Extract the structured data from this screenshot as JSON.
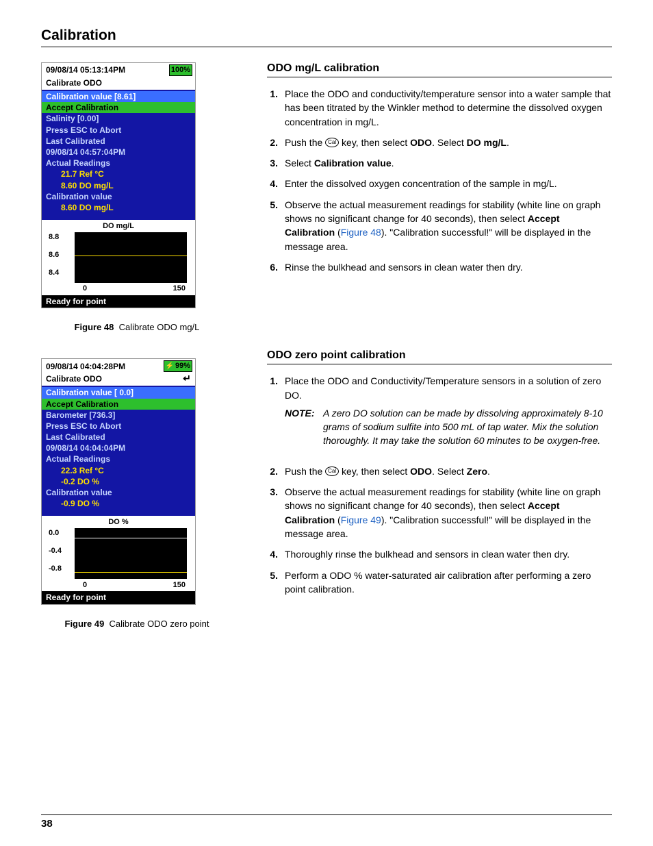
{
  "page_title": "Calibration",
  "page_number": "38",
  "device1": {
    "timestamp": "09/08/14 05:13:14PM",
    "battery": "100%",
    "subtitle": "Calibrate ODO",
    "cal_value_row": "Calibration value [8.61]",
    "accept_row": "Accept Calibration",
    "salinity_row": "Salinity [0.00]",
    "esc_row": "Press ESC to Abort",
    "last_cal_label": "Last Calibrated",
    "last_cal_time": "09/08/14 04:57:04PM",
    "actual_readings_label": "Actual Readings",
    "reading1": "21.7 Ref °C",
    "reading2": "8.60 DO mg/L",
    "cal_value_label": "Calibration value",
    "cal_value_reading": "8.60 DO mg/L",
    "graph_title": "DO mg/L",
    "y1": "8.8",
    "y2": "8.6",
    "y3": "8.4",
    "x1": "0",
    "x2": "150",
    "footer": "Ready for point"
  },
  "fig48": {
    "label": "Figure 48",
    "text": "Calibrate ODO mg/L"
  },
  "device2": {
    "timestamp": "09/08/14 04:04:28PM",
    "battery": "99%",
    "subtitle": "Calibrate ODO",
    "cal_value_row": "Calibration value [ 0.0]",
    "accept_row": "Accept Calibration",
    "barometer_row": "Barometer [736.3]",
    "esc_row": "Press ESC to Abort",
    "last_cal_label": "Last Calibrated",
    "last_cal_time": "09/08/14 04:04:04PM",
    "actual_readings_label": "Actual Readings",
    "reading1": "22.3 Ref °C",
    "reading2": "-0.2 DO %",
    "cal_value_label": "Calibration value",
    "cal_value_reading": "-0.9 DO %",
    "graph_title": "DO %",
    "y1": "0.0",
    "y2": "-0.4",
    "y3": "-0.8",
    "x1": "0",
    "x2": "150",
    "footer": "Ready for point"
  },
  "fig49": {
    "label": "Figure 49",
    "text": "Calibrate ODO zero point"
  },
  "section1": {
    "title": "ODO mg/L calibration",
    "step1": "Place the ODO and conductivity/temperature sensor into a water sample that has been titrated by the Winkler method to determine the dissolved oxygen concentration in mg/L.",
    "step2_pre": "Push the ",
    "step2_mid": " key, then select ",
    "step2_b1": "ODO",
    "step2_mid2": ". Select ",
    "step2_b2": "DO mg/L",
    "step2_post": ".",
    "step3_pre": "Select ",
    "step3_b": "Calibration value",
    "step3_post": ".",
    "step4": "Enter the dissolved oxygen concentration of the sample in mg/L.",
    "step5_pre": "Observe the actual measurement readings for stability (white line on graph shows no significant change for 40 seconds), then select ",
    "step5_b": "Accept Calibration",
    "step5_mid": " (",
    "step5_link": "Figure 48",
    "step5_post": "). \"Calibration successful!\" will be displayed in the message area.",
    "step6": "Rinse the bulkhead and sensors in clean water then dry."
  },
  "section2": {
    "title": "ODO zero point calibration",
    "step1": "Place the ODO and Conductivity/Temperature sensors in a solution of zero DO.",
    "note_label": "NOTE:",
    "note_body": "A zero DO solution can be made by dissolving approximately 8-10 grams of sodium sulfite into 500 mL of tap water. Mix the solution thoroughly. It may take the solution 60 minutes to be oxygen-free.",
    "step2_pre": "Push the ",
    "step2_mid": " key, then select ",
    "step2_b1": "ODO",
    "step2_mid2": ". Select ",
    "step2_b2": "Zero",
    "step2_post": ".",
    "step3_pre": "Observe the actual measurement readings for stability (white line on graph shows no significant change for 40 seconds), then select ",
    "step3_b": "Accept Calibration",
    "step3_mid": " (",
    "step3_link": "Figure 49",
    "step3_post": "). \"Calibration successful!\" will be displayed in the message area.",
    "step4": "Thoroughly rinse the bulkhead and sensors in clean water then dry.",
    "step5": "Perform a ODO % water-saturated air calibration after performing a zero point calibration."
  },
  "cal_key_label": "Cal",
  "chart_data": [
    {
      "type": "line",
      "title": "DO mg/L",
      "x": [
        0,
        150
      ],
      "ylim": [
        8.4,
        8.8
      ],
      "yticks": [
        8.8,
        8.6,
        8.4
      ],
      "xticks": [
        0,
        150
      ],
      "series": [
        {
          "name": "reading",
          "values": [
            8.6,
            8.6
          ]
        }
      ]
    },
    {
      "type": "line",
      "title": "DO %",
      "x": [
        0,
        150
      ],
      "ylim": [
        -0.8,
        0.0
      ],
      "yticks": [
        0.0,
        -0.4,
        -0.8
      ],
      "xticks": [
        0,
        150
      ],
      "series": [
        {
          "name": "reading",
          "values": [
            -0.2,
            -0.2
          ]
        },
        {
          "name": "cal-value",
          "values": [
            -0.9,
            -0.9
          ]
        }
      ]
    }
  ]
}
